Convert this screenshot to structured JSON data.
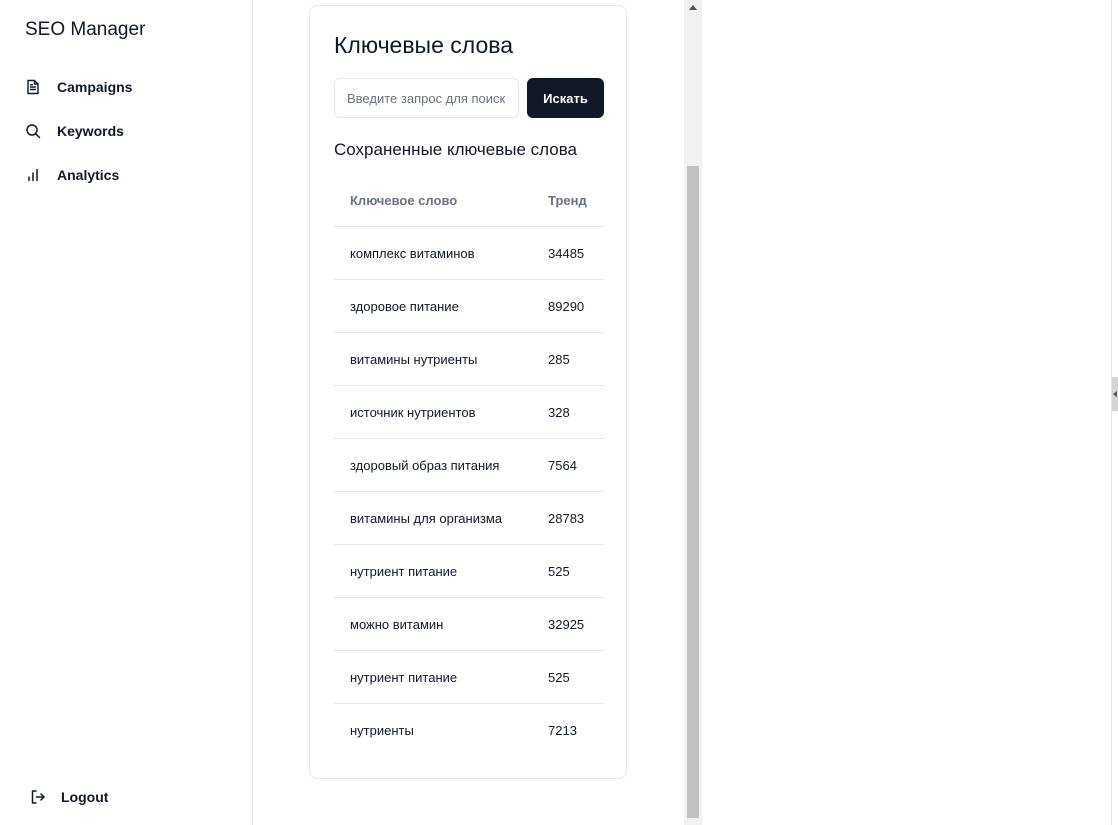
{
  "app": {
    "brand": "SEO Manager"
  },
  "sidebar": {
    "items": [
      {
        "label": "Campaigns",
        "icon": "document-icon"
      },
      {
        "label": "Keywords",
        "icon": "search-icon"
      },
      {
        "label": "Analytics",
        "icon": "bar-chart-icon"
      }
    ],
    "logout_label": "Logout"
  },
  "card": {
    "title": "Ключевые слова",
    "search": {
      "placeholder": "Введите запрос для поиска",
      "value": ""
    },
    "search_button_label": "Искать",
    "saved_title": "Сохраненные ключевые слова",
    "table": {
      "headers": [
        "Ключевое слово",
        "Тренд"
      ],
      "rows": [
        [
          "комплекс витаминов",
          "34485"
        ],
        [
          "здоровое питание",
          "89290"
        ],
        [
          "витамины нутриенты",
          "285"
        ],
        [
          "источник нутриентов",
          "328"
        ],
        [
          "здоровый образ питания",
          "7564"
        ],
        [
          "витамины для организма",
          "28783"
        ],
        [
          "нутриент питание",
          "525"
        ],
        [
          "можно витамин",
          "32925"
        ],
        [
          "нутриент питание",
          "525"
        ],
        [
          "нутриенты",
          "7213"
        ]
      ]
    }
  },
  "colors": {
    "primary": "#111827",
    "muted": "#6b7280",
    "border": "#e5e7eb"
  }
}
